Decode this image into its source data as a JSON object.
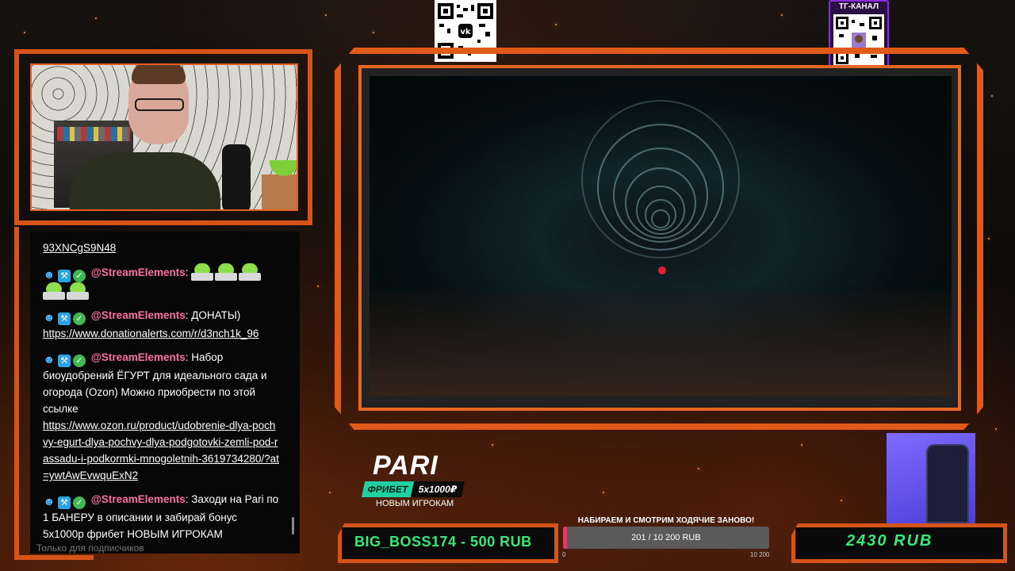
{
  "qr": {
    "tg_label": "ТГ-КАНАЛ"
  },
  "chat": {
    "truncated_top": "93XNCgS9N48",
    "messages": [
      {
        "user": "@StreamElements",
        "sep": ":",
        "text": "",
        "emotes": 5
      },
      {
        "user": "@StreamElements",
        "sep": ":",
        "text": " ДОНАТЫ)",
        "link": "https://www.donationalerts.com/r/d3nch1k_96"
      },
      {
        "user": "@StreamElements",
        "sep": ":",
        "text": " Набор биоудобрений ЁГУРТ для идеального сада и огорода (Ozon) Можно приобрести по этой ссылке",
        "link": "https://www.ozon.ru/product/udobrenie-dlya-pochvy-egurt-dlya-pochvy-dlya-podgotovki-zemli-pod-rassadu-i-podkormki-mnogoletnih-3619734280/?at=ywtAwEvwquExN2"
      },
      {
        "user": "@StreamElements",
        "sep": ":",
        "text": " Заходи на Pari по 1 БАНЕРУ в описании и забирай бонус 5x1000р фрибет НОВЫМ ИГРОКАМ"
      }
    ],
    "faded_bottom": "Только для подписчиков"
  },
  "pari": {
    "logo": "PARI",
    "freebet": "ФРИБЕТ",
    "amount": "5x1000₽",
    "new_players": "НОВЫМ ИГРОКАМ"
  },
  "donation": {
    "last": "BIG_BOSS174 - 500 RUB",
    "total": "2430 RUB"
  },
  "goal": {
    "title": "НАБИРАЕМ И СМОТРИМ ХОДЯЧИЕ ЗАНОВО!",
    "text": "201 / 10 200 RUB",
    "min": "0",
    "max": "10 200",
    "progress": 0.0197
  },
  "colors": {
    "accent": "#e2591a",
    "donation_green": "#38e878",
    "goal_fill": "#e03a6a",
    "chat_user": "#ff6fa3"
  }
}
